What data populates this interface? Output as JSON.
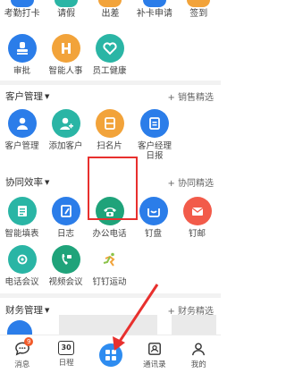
{
  "top_row": {
    "items": [
      {
        "label": "考勤打卡",
        "color": "#2b7de9"
      },
      {
        "label": "请假",
        "color": "#2ab5a5"
      },
      {
        "label": "出差",
        "color": "#f2a33a"
      },
      {
        "label": "补卡申请",
        "color": "#2b7de9"
      },
      {
        "label": "签到",
        "color": "#f2a33a"
      }
    ]
  },
  "approval_row": {
    "items": [
      {
        "label": "审批",
        "icon": "stamp-icon",
        "color": "#2b7de9"
      },
      {
        "label": "智能人事",
        "icon": "h-letter-icon",
        "color": "#f2a33a"
      },
      {
        "label": "员工健康",
        "icon": "heart-icon",
        "color": "#2ab5a5"
      }
    ]
  },
  "customer_section": {
    "title": "客户管理",
    "more": "+ 销售精选",
    "items": [
      {
        "label": "客户管理",
        "icon": "user-icon",
        "color": "#2b7de9"
      },
      {
        "label": "添加客户",
        "icon": "add-user-icon",
        "color": "#2ab5a5"
      },
      {
        "label": "扫名片",
        "icon": "card-scan-icon",
        "color": "#f2a33a"
      },
      {
        "label": "客户经理\n日报",
        "label_line1": "客户经理",
        "label_line2": "日报",
        "icon": "report-icon",
        "color": "#2b7de9"
      }
    ]
  },
  "collab_section": {
    "title": "协同效率",
    "more": "+ 协同精选",
    "row1": [
      {
        "label": "智能填表",
        "icon": "form-icon",
        "color": "#2ab5a5"
      },
      {
        "label": "日志",
        "icon": "notebook-icon",
        "color": "#2b7de9"
      },
      {
        "label": "办公电话",
        "icon": "phone-icon",
        "color": "#1fa37a"
      },
      {
        "label": "钉盘",
        "icon": "cloud-disk-icon",
        "color": "#2b7de9"
      },
      {
        "label": "钉邮",
        "icon": "mail-icon",
        "color": "#f25b4a"
      }
    ],
    "row2": [
      {
        "label": "电话会议",
        "icon": "conference-call-icon",
        "color": "#2ab5a5"
      },
      {
        "label": "视频会议",
        "icon": "video-call-icon",
        "color": "#1fa37a"
      },
      {
        "label": "钉钉运动",
        "icon": "running-icon",
        "color": "#8bc34a"
      }
    ]
  },
  "finance_section": {
    "title": "财务管理",
    "more": "+ 财务精选"
  },
  "bottom_tabs": [
    {
      "label": "消息",
      "icon": "chat-icon",
      "badge": "9"
    },
    {
      "label": "日程",
      "icon": "calendar-icon",
      "date": "30"
    },
    {
      "label": "",
      "icon": "grid-icon"
    },
    {
      "label": "通讯录",
      "icon": "contacts-icon"
    },
    {
      "label": "我的",
      "icon": "profile-icon"
    }
  ],
  "colors": {
    "highlight": "#e8302e",
    "accent": "#2e8cf0"
  }
}
